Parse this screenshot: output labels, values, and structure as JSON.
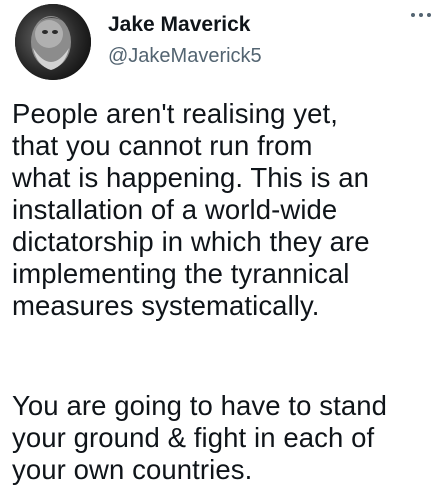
{
  "tweet": {
    "author": {
      "display_name": "Jake Maverick",
      "handle": "@JakeMaverick5",
      "avatar_icon": "avatar-profile-photo"
    },
    "more_icon": "more-horizontal-icon",
    "paragraphs": [
      {
        "lines": [
          "People aren't realising yet,",
          "that you cannot run from",
          "what is happening. This is an",
          "installation of a world-wide",
          "dictatorship in which they are",
          "implementing the tyrannical",
          "measures systematically."
        ]
      },
      {
        "lines": [
          "You are going to have to stand",
          "your ground & fight in each of",
          "your own countries."
        ]
      }
    ]
  },
  "colors": {
    "text_primary": "#0f1419",
    "text_secondary": "#536471",
    "background": "#ffffff"
  }
}
